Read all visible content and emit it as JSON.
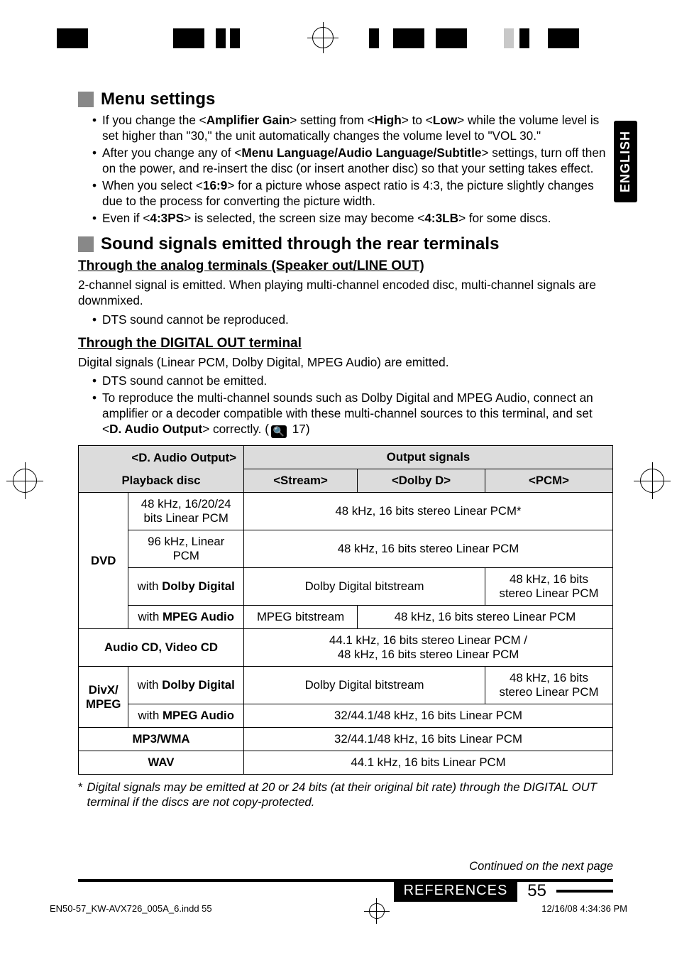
{
  "language_tab": "ENGLISH",
  "sections": {
    "menu": {
      "title": "Menu settings",
      "bullets": [
        {
          "pre": "If you change the <",
          "b1": "Amplifier Gain",
          "mid1": "> setting from <",
          "b2": "High",
          "mid2": "> to <",
          "b3": "Low",
          "post": "> while the volume level is set higher than \"30,\" the unit automatically changes the volume level to \"VOL 30.\""
        },
        {
          "pre": "After you change any of <",
          "b1": "Menu Language/Audio Language/Subtitle",
          "post": "> settings, turn off then on the power, and re-insert the disc (or insert another disc) so that your setting takes effect."
        },
        {
          "pre": "When you select <",
          "b1": "16:9",
          "post": "> for a picture whose aspect ratio is 4:3, the picture slightly changes due to the process for converting the picture width."
        },
        {
          "pre": "Even if <",
          "b1": "4:3PS",
          "mid1": "> is selected, the screen size may become <",
          "b2": "4:3LB",
          "post": "> for some discs."
        }
      ]
    },
    "sound": {
      "title": "Sound signals emitted through the rear terminals",
      "analog_h": "Through the analog terminals (Speaker out/LINE OUT)",
      "analog_p": "2-channel signal is emitted. When playing multi-channel encoded disc, multi-channel signals are downmixed.",
      "analog_b1": "DTS sound cannot be reproduced.",
      "digital_h": "Through the DIGITAL OUT terminal",
      "digital_p": "Digital signals (Linear PCM, Dolby Digital, MPEG Audio) are emitted.",
      "digital_b1": "DTS sound cannot be emitted.",
      "digital_b2_pre": "To reproduce the multi-channel sounds such as Dolby Digital and MPEG Audio, connect an amplifier or a decoder compatible with these multi-channel sources to this terminal, and set <",
      "digital_b2_bold": "D. Audio Output",
      "digital_b2_post": "> correctly. (",
      "digital_b2_ref": "17)"
    }
  },
  "table": {
    "h_daudio": "<D. Audio Output>",
    "h_output": "Output signals",
    "h_playback": "Playback disc",
    "h_stream": "<Stream>",
    "h_dolby": "<Dolby D>",
    "h_pcm": "<PCM>",
    "dvd_label": "DVD",
    "dvd_r1_a": "48 kHz, 16/20/24 bits Linear PCM",
    "dvd_r1_b": "48 kHz, 16 bits stereo Linear PCM*",
    "dvd_r2_a": "96 kHz, Linear PCM",
    "dvd_r2_b": "48 kHz, 16 bits stereo Linear PCM",
    "dvd_r3_a_pre": "with ",
    "dvd_r3_a_b": "Dolby Digital",
    "dvd_r3_b": "Dolby Digital bitstream",
    "dvd_r3_c": "48 kHz, 16 bits stereo Linear PCM",
    "dvd_r4_a_pre": "with ",
    "dvd_r4_a_b": "MPEG Audio",
    "dvd_r4_b": "MPEG bitstream",
    "dvd_r4_c": "48 kHz, 16 bits stereo Linear PCM",
    "acd_label": "Audio CD, Video CD",
    "acd_val_l1": "44.1 kHz, 16 bits stereo Linear PCM /",
    "acd_val_l2": "48 kHz, 16 bits stereo Linear PCM",
    "divx_label": "DivX/ MPEG",
    "divx_r1_a_pre": "with ",
    "divx_r1_a_b": "Dolby Digital",
    "divx_r1_b": "Dolby Digital bitstream",
    "divx_r1_c": "48 kHz, 16 bits stereo Linear PCM",
    "divx_r2_a_pre": "with ",
    "divx_r2_a_b": "MPEG Audio",
    "divx_r2_b": "32/44.1/48 kHz, 16 bits Linear PCM",
    "mp3_label": "MP3/WMA",
    "mp3_val": "32/44.1/48 kHz, 16 bits Linear PCM",
    "wav_label": "WAV",
    "wav_val": "44.1 kHz, 16 bits Linear PCM"
  },
  "footnote": "Digital signals may be emitted at 20 or 24 bits (at their original bit rate) through the DIGITAL OUT terminal if the discs are not copy-protected.",
  "continued": "Continued on the next page",
  "references_label": "REFERENCES",
  "page_number": "55",
  "print_file": "EN50-57_KW-AVX726_005A_6.indd   55",
  "print_time": "12/16/08   4:34:36 PM"
}
